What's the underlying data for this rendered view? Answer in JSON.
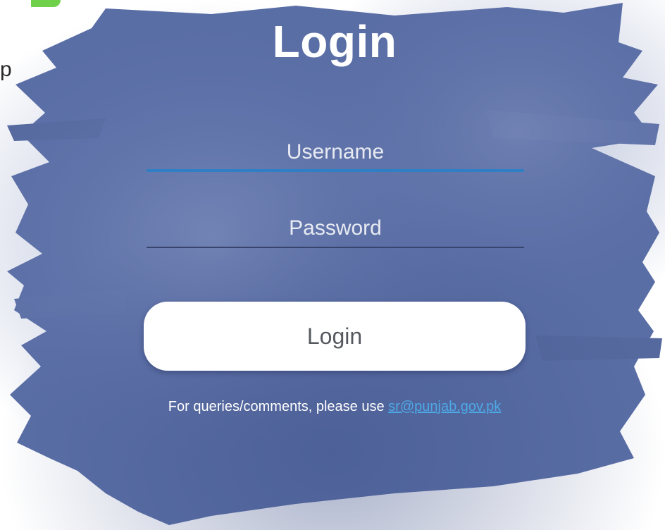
{
  "login_form": {
    "title": "Login",
    "username_placeholder": "Username",
    "password_placeholder": "Password",
    "submit_label": "Login",
    "footer_text": "For queries/comments, please use ",
    "footer_link_text": "sr@punjab.gov.pk"
  },
  "colors": {
    "brush_fill": "#5a6ea6",
    "active_underline": "#2f7fc4",
    "link": "#4da8e6",
    "accent_green": "#6fd14a"
  },
  "icons": {
    "corner_mark": "green-swoosh-icon",
    "side_glyph": "partial-letter-glyph"
  }
}
